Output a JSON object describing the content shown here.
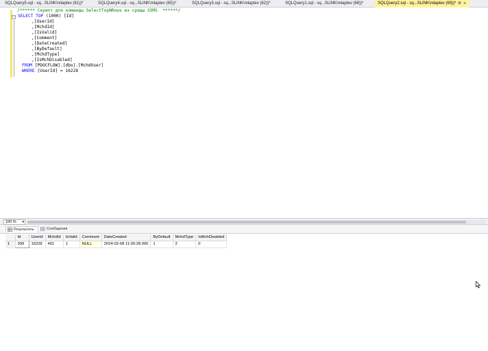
{
  "tabs": [
    {
      "label": "SQLQuery5.sql - sq...SLINK\\mlaptev (61))*",
      "active": false
    },
    {
      "label": "SQLQuery4.sql - sq...SLINK\\mlaptev (65))*",
      "active": false
    },
    {
      "label": "SQLQuery3.sql - sq...SLINK\\mlaptev (62))*",
      "active": false
    },
    {
      "label": "SQLQuery1.sql - sq...SLINK\\mlaptev (68))*",
      "active": false
    },
    {
      "label": "SQLQuery2.sql - sq...SLINK\\mlaptev (69))*",
      "active": true
    }
  ],
  "tab_pin_glyph": "⊕",
  "tab_close_glyph": "×",
  "editor": {
    "comment": "/****** Скрипт для команды SelectTopNRows из среды SSMS  ******/",
    "select_kw": "SELECT",
    "top_kw": "TOP",
    "top_value": "(1000) [Id]",
    "columns": [
      ",[UserId]",
      ",[MchdId]",
      ",[IsValid]",
      ",[Comment]",
      ",[DateCreated]",
      ",[ByDefault]",
      ",[MchdType]",
      ",[IsMchDisabled]"
    ],
    "from_kw": "FROM",
    "from_table": "[PDOCFLOW].[dbo].[MchdUser]",
    "where_kw": "WHERE",
    "where_cond": "[UserId] = 16228"
  },
  "zoom": {
    "value": "100 %",
    "arrow": "▾"
  },
  "results_tabs": [
    {
      "label": "Результаты",
      "active": true
    },
    {
      "label": "Сообщения",
      "active": false
    }
  ],
  "grid": {
    "columns": [
      "Id",
      "UserId",
      "MchdId",
      "IsValid",
      "Comment",
      "DateCreated",
      "ByDefault",
      "MchdType",
      "IsMchDisabled"
    ],
    "rows": [
      {
        "rownum": "1",
        "cells": [
          "399",
          "16228",
          "401",
          "1",
          "NULL",
          "2024-02-08 11:00:28.000",
          "1",
          "2",
          "0"
        ]
      }
    ]
  },
  "colors": {
    "active_tab": "#fff29d",
    "keyword": "#0000ff",
    "comment": "#008000",
    "null_cell": "#ffffe1"
  }
}
